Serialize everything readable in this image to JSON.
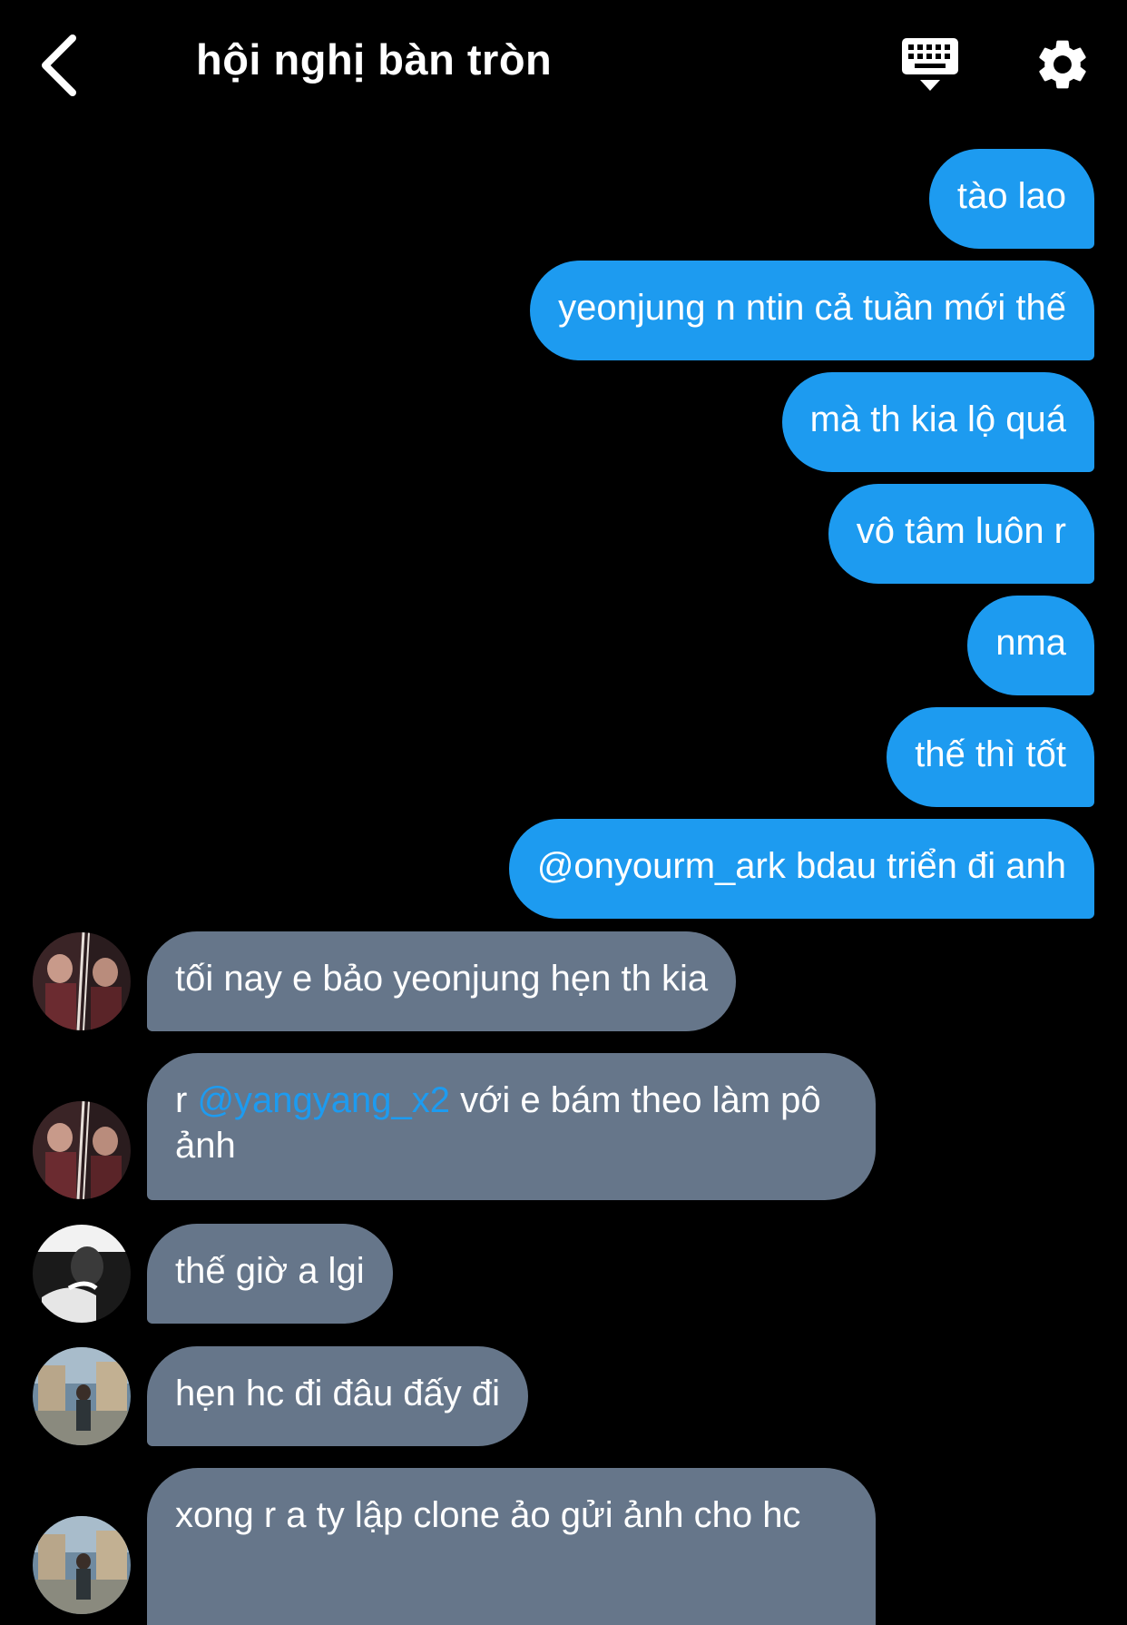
{
  "header": {
    "title": "hội nghị bàn tròn"
  },
  "icons": {
    "back": "chevron-left-icon",
    "keyboard": "keyboard-icon",
    "settings": "gear-icon"
  },
  "colors": {
    "background": "#000000",
    "outgoing_bubble": "#1d9bf0",
    "incoming_bubble": "#66768a",
    "mention": "#1d9bf0"
  },
  "outgoing": [
    {
      "text": "tào lao"
    },
    {
      "text": "yeonjung n ntin cả tuần mới thế"
    },
    {
      "text": "mà th kia lộ quá"
    },
    {
      "text": "vô tâm luôn r"
    },
    {
      "text": "nma"
    },
    {
      "text": "thế thì tốt"
    },
    {
      "text": "@onyourm_ark bdau triển đi anh"
    }
  ],
  "incoming": [
    {
      "text": "tối nay e bảo yeonjung hẹn th kia"
    },
    {
      "prefix": "r ",
      "mention": "@yangyang_x2",
      "suffix": " với e bám theo làm pô ảnh"
    },
    {
      "text": "thế giờ a lgi"
    },
    {
      "text": "hẹn hc đi đâu đấy đi"
    },
    {
      "text": "xong r a ty lập clone ảo gửi ảnh cho hc"
    }
  ]
}
